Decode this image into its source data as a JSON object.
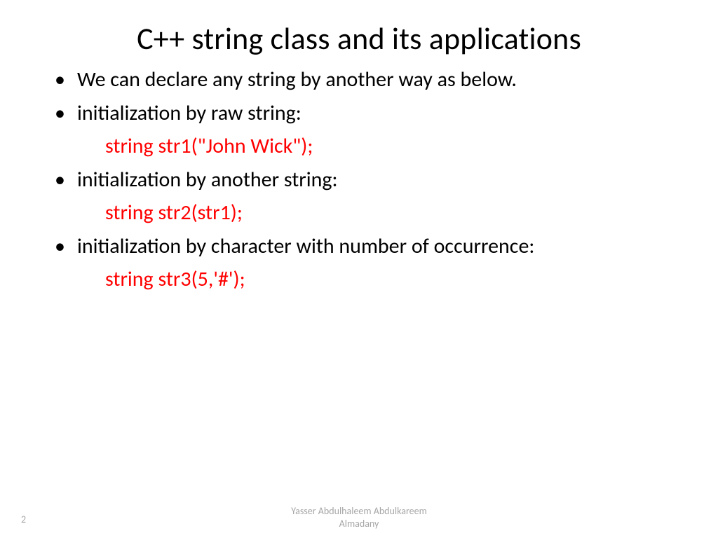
{
  "title": "C++ string class and its applications",
  "bullets": {
    "b0": "We can declare any string by another way as below.",
    "b1": "initialization by raw string:",
    "b2": "initialization by another string:",
    "b3": "initialization by character with number of occurrence:"
  },
  "code": {
    "c1": "string str1(\"John Wick\");",
    "c2": "string str2(str1);",
    "c3": "string str3(5,'#');"
  },
  "footer": {
    "page": "2",
    "author_line1": "Yasser Abdulhaleem Abdulkareem",
    "author_line2": "Almadany"
  }
}
